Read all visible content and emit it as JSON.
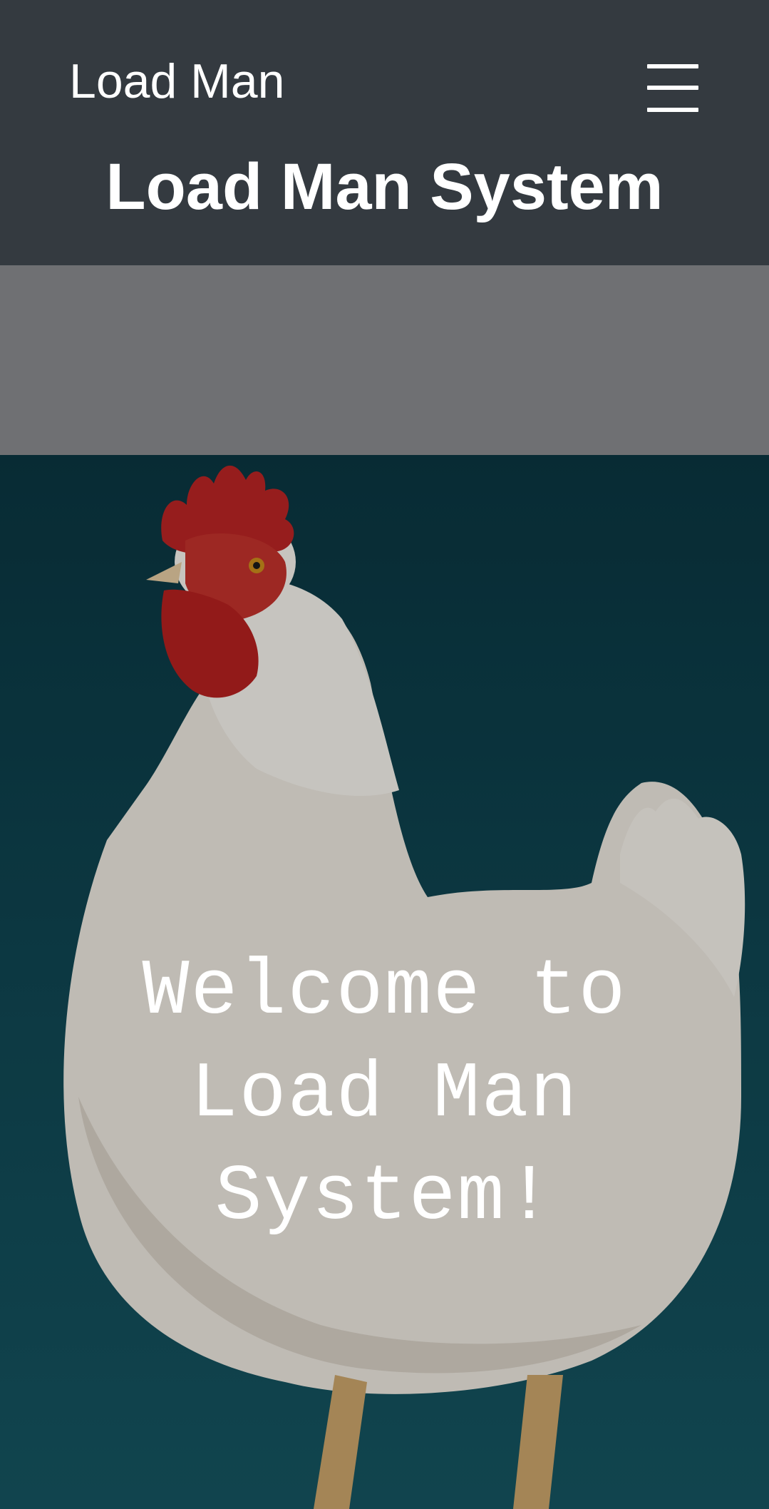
{
  "navbar": {
    "brand": "Load Man",
    "toggler_icon": "hamburger-menu-icon",
    "background": "#343a40"
  },
  "header": {
    "title": "Load Man System"
  },
  "hero": {
    "image": "white-rooster-photo",
    "welcome_lines": [
      "Welcome to",
      "Load Man",
      "System!"
    ],
    "background": "#0f4450"
  }
}
